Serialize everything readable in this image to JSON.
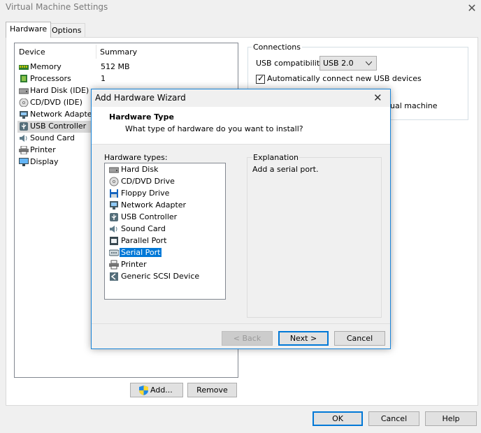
{
  "window": {
    "title": "Virtual Machine Settings",
    "close_glyph": "✕"
  },
  "tabs": [
    {
      "label": "Hardware"
    },
    {
      "label": "Options"
    }
  ],
  "device_list": {
    "col_device": "Device",
    "col_summary": "Summary",
    "items": [
      {
        "name": "Memory",
        "summary": "512 MB",
        "icon": "memory-icon"
      },
      {
        "name": "Processors",
        "summary": "1",
        "icon": "processor-icon"
      },
      {
        "name": "Hard Disk (IDE)",
        "summary": "",
        "icon": "hard-disk-icon"
      },
      {
        "name": "CD/DVD (IDE)",
        "summary": "",
        "icon": "cd-dvd-icon"
      },
      {
        "name": "Network Adapter",
        "summary": "",
        "icon": "network-adapter-icon"
      },
      {
        "name": "USB Controller",
        "summary": "",
        "icon": "usb-icon"
      },
      {
        "name": "Sound Card",
        "summary": "",
        "icon": "sound-icon"
      },
      {
        "name": "Printer",
        "summary": "",
        "icon": "printer-icon"
      },
      {
        "name": "Display",
        "summary": "",
        "icon": "display-icon"
      }
    ]
  },
  "buttons": {
    "add": "Add...",
    "remove": "Remove",
    "ok": "OK",
    "cancel": "Cancel",
    "help": "Help"
  },
  "connections": {
    "label": "Connections",
    "usb_compat_label": "USB compatibility:",
    "usb_compat_value": "USB 2.0",
    "auto_connect_label": "Automatically connect new USB devices",
    "partial_label": "ual machine"
  },
  "wizard": {
    "title": "Add Hardware Wizard",
    "close_glyph": "✕",
    "heading": "Hardware Type",
    "subheading": "What type of hardware do you want to install?",
    "hardware_types_label": "Hardware types:",
    "hardware_types": [
      {
        "label": "Hard Disk",
        "icon": "hard-disk-icon"
      },
      {
        "label": "CD/DVD Drive",
        "icon": "cd-dvd-icon"
      },
      {
        "label": "Floppy Drive",
        "icon": "floppy-icon"
      },
      {
        "label": "Network Adapter",
        "icon": "network-adapter-icon"
      },
      {
        "label": "USB Controller",
        "icon": "usb-icon"
      },
      {
        "label": "Sound Card",
        "icon": "sound-icon"
      },
      {
        "label": "Parallel Port",
        "icon": "parallel-port-icon"
      },
      {
        "label": "Serial Port",
        "icon": "serial-port-icon"
      },
      {
        "label": "Printer",
        "icon": "printer-icon"
      },
      {
        "label": "Generic SCSI Device",
        "icon": "scsi-icon"
      }
    ],
    "selected_index": 7,
    "explanation_label": "Explanation",
    "explanation_text": "Add a serial port.",
    "back": "< Back",
    "next": "Next >",
    "cancel": "Cancel"
  },
  "colors": {
    "accent": "#0078d7",
    "selection_gray": "#d9d9d9"
  }
}
